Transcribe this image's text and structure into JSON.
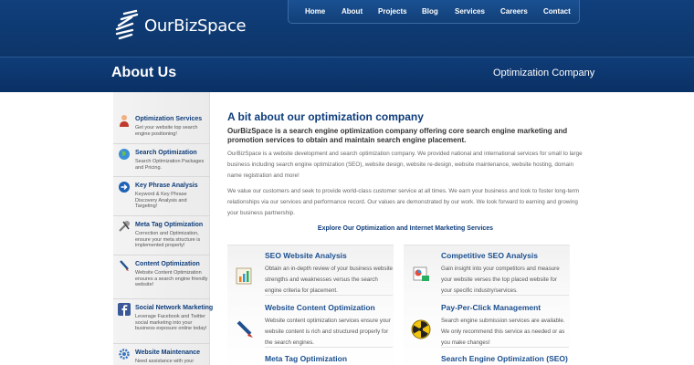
{
  "header": {
    "logo_text": "OurBizSpace",
    "nav": [
      "Home",
      "About",
      "Projects",
      "Blog",
      "Services",
      "Careers",
      "Contact"
    ]
  },
  "banner": {
    "title": "About Us",
    "subtitle": "Optimization Company"
  },
  "sidebar": {
    "items": [
      {
        "title": "Optimization Services",
        "desc": "Get your website top search engine positioning!",
        "icon": "person-icon"
      },
      {
        "title": "Search Optimization",
        "desc": "Search Optimization Packages and Pricing.",
        "icon": "globe-icon"
      },
      {
        "title": "Key Phrase Analysis",
        "desc": "Keyword & Key Phrase Discovery Analysis and Targeting!",
        "icon": "arrow-circle-icon"
      },
      {
        "title": "Meta Tag Optimization",
        "desc": "Correction and Optimization, ensure your meta structure is implemented properly!",
        "icon": "tools-icon"
      },
      {
        "title": "Content Optimization",
        "desc": "Website Content Optimization ensures a search engine friendly website!",
        "icon": "pen-icon"
      },
      {
        "title": "Social Network Marketing",
        "desc": "Leverage Facebook and Twitter social marketing into your business exposure online today!",
        "icon": "facebook-icon"
      },
      {
        "title": "Website Maintenance",
        "desc": "Need assistance with your",
        "icon": "gear-icon"
      }
    ]
  },
  "main": {
    "heading": "A bit about our optimization company",
    "lead": "OurBizSpace is a search engine optimization company offering core search engine marketing and promotion services to obtain and maintain search engine placement.",
    "p1": "OurBizSpace is a website development and search optimization company. We provided national and international services for small to large business including search engine optimization (SEO), website design, website re-design, website maintenance, website hosting, domain name registration and more!",
    "p2": "We value our customers and seek to provide world-class customer service at all times. We earn your business and look to foster long-term relationships via our services and performance record. Our values are demonstrated by our work. We look forward to earning and growing your business partnership.",
    "explore": "Explore Our Optimization and Internet Marketing Services",
    "services_left": [
      {
        "title": "SEO Website Analysis",
        "desc": "Obtain an in-depth review of your business website strengths and weaknesses versus the search engine criteria for placement.",
        "icon": "chart-icon"
      },
      {
        "title": "Website Content Optimization",
        "desc": "Website content optimization services ensure your website content is rich and structured properly for the search engines.",
        "icon": "pen-icon"
      },
      {
        "title": "Meta Tag Optimization",
        "desc": "",
        "icon": ""
      }
    ],
    "services_right": [
      {
        "title": "Competitive SEO Analysis",
        "desc": "Gain insight into your competitors and measure your website verses the top placed website for your specific industry/services.",
        "icon": "report-icon"
      },
      {
        "title": "Pay-Per-Click Management",
        "desc": "Search engine submission services are available. We only recommend this service as needed or as you make changes!",
        "icon": "radiation-icon"
      },
      {
        "title": "Search Engine Optimization (SEO)",
        "desc": "",
        "icon": ""
      }
    ]
  }
}
